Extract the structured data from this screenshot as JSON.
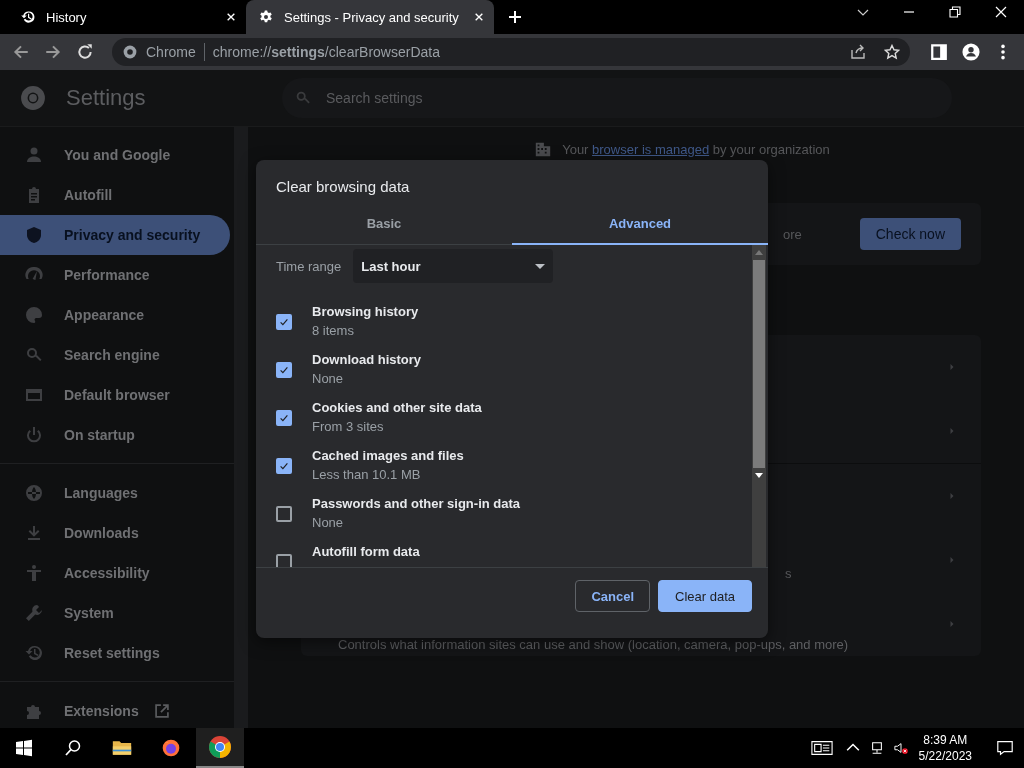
{
  "tabs": [
    {
      "title": "History",
      "selected": false
    },
    {
      "title": "Settings - Privacy and security",
      "selected": true
    }
  ],
  "address_bar": {
    "site": "Chrome",
    "url": "chrome://**settings**/clearBrowserData"
  },
  "settings_header": {
    "title": "Settings",
    "search_placeholder": "Search settings"
  },
  "sidebar": {
    "groups": [
      [
        {
          "label": "You and Google",
          "selected": false
        },
        {
          "label": "Autofill",
          "selected": false
        },
        {
          "label": "Privacy and security",
          "selected": true
        },
        {
          "label": "Performance",
          "selected": false
        },
        {
          "label": "Appearance",
          "selected": false
        },
        {
          "label": "Search engine",
          "selected": false
        },
        {
          "label": "Default browser",
          "selected": false
        },
        {
          "label": "On startup",
          "selected": false
        }
      ],
      [
        {
          "label": "Languages",
          "selected": false
        },
        {
          "label": "Downloads",
          "selected": false
        },
        {
          "label": "Accessibility",
          "selected": false
        },
        {
          "label": "System",
          "selected": false
        },
        {
          "label": "Reset settings",
          "selected": false
        }
      ],
      [
        {
          "label": "Extensions",
          "selected": false
        }
      ]
    ]
  },
  "managed_notice": {
    "before": "Your ",
    "link": "browser is managed",
    "after": " by your organization"
  },
  "background": {
    "fragment_1": "ore",
    "button": "Check now",
    "fragment_2": "s",
    "description": "Controls what information sites can use and show (location, camera, pop-ups, and more)"
  },
  "dialog": {
    "title": "Clear browsing data",
    "tabs": [
      {
        "label": "Basic",
        "selected": false
      },
      {
        "label": "Advanced",
        "selected": true
      }
    ],
    "time_range": {
      "label": "Time range",
      "value": "Last hour"
    },
    "items": [
      {
        "label": "Browsing history",
        "detail": "8 items",
        "checked": true
      },
      {
        "label": "Download history",
        "detail": "None",
        "checked": true
      },
      {
        "label": "Cookies and other site data",
        "detail": "From 3 sites",
        "checked": true
      },
      {
        "label": "Cached images and files",
        "detail": "Less than 10.1 MB",
        "checked": true
      },
      {
        "label": "Passwords and other sign-in data",
        "detail": "None",
        "checked": false
      },
      {
        "label": "Autofill form data",
        "checked": false
      }
    ],
    "buttons": [
      {
        "label": "Cancel",
        "kind": "secondary"
      },
      {
        "label": "Clear data",
        "kind": "primary"
      }
    ]
  },
  "taskbar": {
    "time": "8:39 AM",
    "date": "5/22/2023"
  }
}
